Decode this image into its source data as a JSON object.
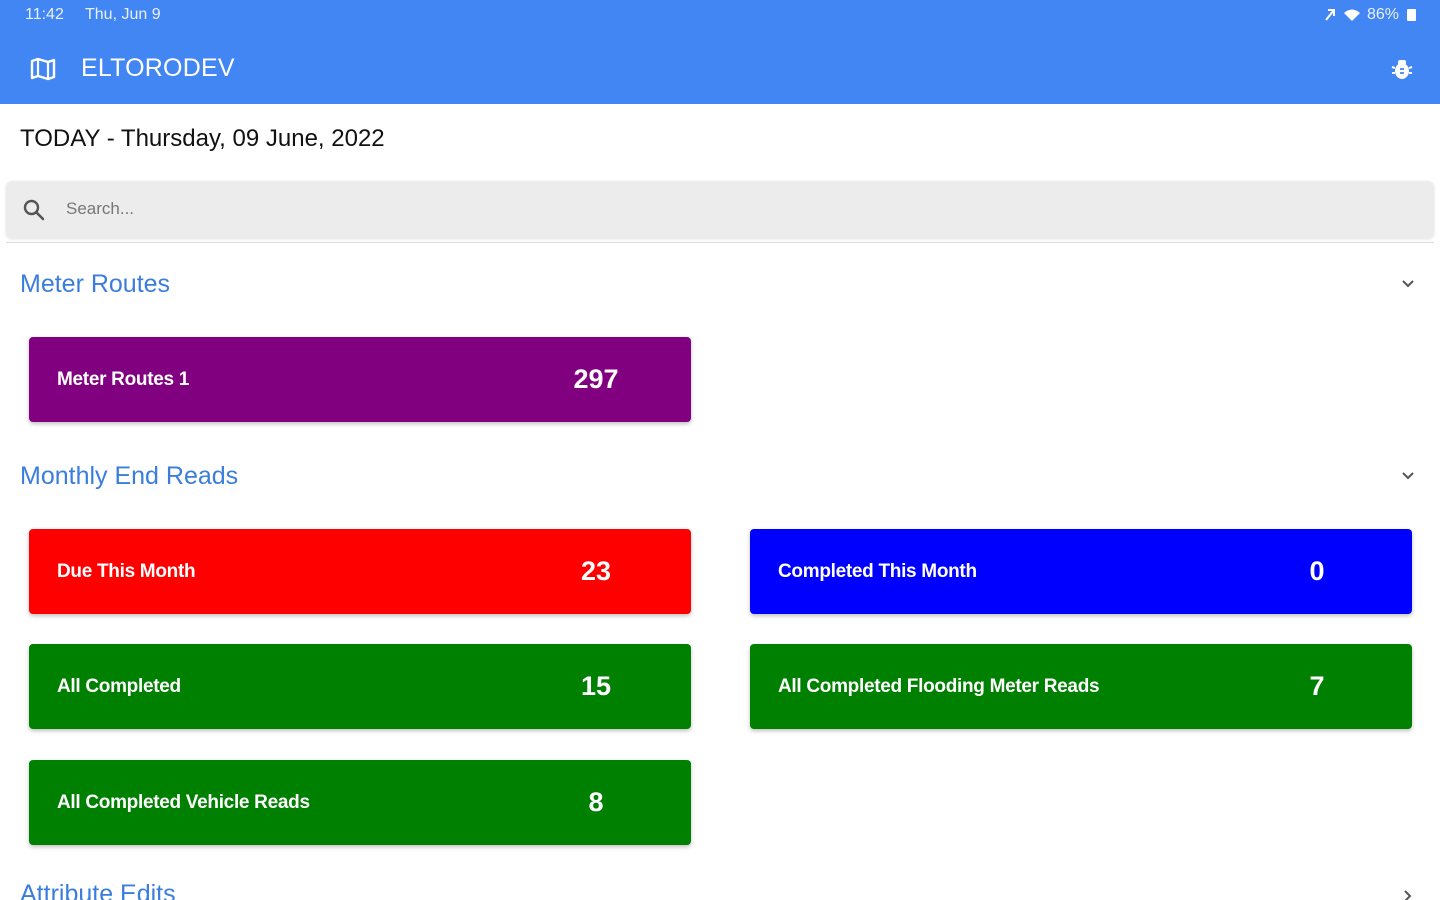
{
  "status_bar": {
    "time": "11:42",
    "date": "Thu, Jun 9",
    "battery": "86%"
  },
  "app_bar": {
    "title": "ELTORODEV",
    "color": "#4286F4",
    "left_icon": "map-icon",
    "right_icon": "bug-icon"
  },
  "date_line": "TODAY - Thursday, 09 June, 2022",
  "search": {
    "placeholder": "Search...",
    "value": ""
  },
  "sections": {
    "meter_routes": {
      "title": "Meter Routes",
      "tiles": [
        {
          "label": "Meter Routes 1",
          "count": "297",
          "color": "#800080"
        }
      ]
    },
    "monthly_end_reads": {
      "title": "Monthly End Reads",
      "tiles": [
        {
          "label": "Due This Month",
          "count": "23",
          "color": "#FF0000"
        },
        {
          "label": "Completed This Month",
          "count": "0",
          "color": "#0000FF"
        },
        {
          "label": "All Completed",
          "count": "15",
          "color": "#008000"
        },
        {
          "label": "All Completed Flooding Meter Reads",
          "count": "7",
          "color": "#008000"
        },
        {
          "label": "All Completed Vehicle Reads",
          "count": "8",
          "color": "#008000"
        }
      ]
    },
    "attribute_edits": {
      "title": "Attribute Edits"
    }
  },
  "accent_color": "#3B7DDD"
}
